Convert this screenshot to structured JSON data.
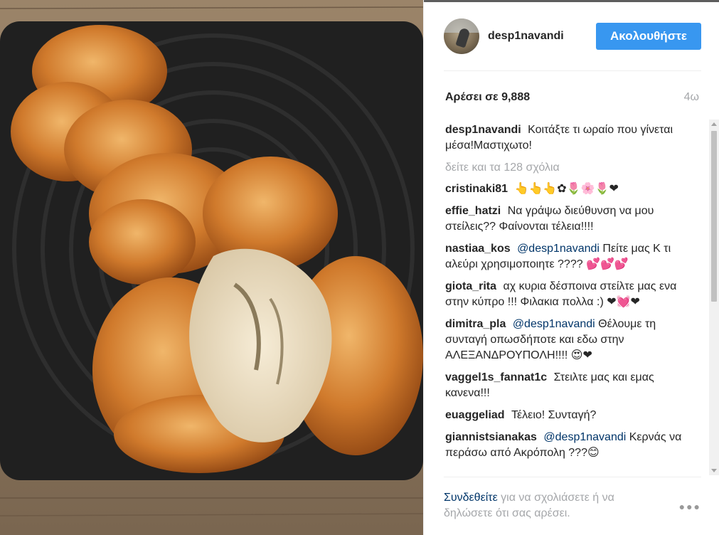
{
  "post": {
    "image_alt": "Braided mastic bread on a dark wooden plate",
    "username": "desp1navandi",
    "follow_label": "Ακολουθήστε",
    "likes_text": "Αρέσει σε 9,888",
    "time_ago": "4ω"
  },
  "caption": {
    "author": "desp1navandi",
    "text": "Κοιτάξτε τι ωραίο που γίνεται μέσα!Μαστιχωτο!"
  },
  "view_all_label": "δείτε και τα 128 σχόλια",
  "comments": [
    {
      "author": "cristinaki81",
      "text": "👆👆👆✿🌷🌸🌷❤"
    },
    {
      "author": "effie_hatzi",
      "text": "Να γράψω διεύθυνση να μου στείλεις?? Φαίνονται τέλεια!!!!"
    },
    {
      "author": "nastiaa_kos",
      "mention": "@desp1navandi",
      "text": "Πείτε μας Κ τι αλεύρι χρησιμοποιητε ???? 💕💕💕"
    },
    {
      "author": "giota_rita",
      "text": "αχ κυρια δέσποινα στείλτε μας ενα στην κύπρο !!! Φιλακια πολλα :) ❤💓❤"
    },
    {
      "author": "dimitra_pla",
      "mention": "@desp1navandi",
      "text": "Θέλουμε τη συνταγή οπωσδήποτε και εδω στην ΑΛΕΞΑΝΔΡΟΥΠΟΛΗ!!!! 😍❤"
    },
    {
      "author": "vaggel1s_fannat1c",
      "text": "Στειλτε μας και εμας κανενα!!!"
    },
    {
      "author": "euaggeliad",
      "text": "Τέλειο! Συνταγή?"
    },
    {
      "author": "giannistsianakas",
      "mention": "@desp1navandi",
      "text": "Κερνάς να περάσω από Ακρόπολη ???😊"
    }
  ],
  "footer": {
    "login_link": "Συνδεθείτε",
    "rest_text": "για να σχολιάσετε ή να δηλώσετε ότι σας αρέσει."
  },
  "icons": {
    "options": "more-options-icon"
  },
  "colors": {
    "accent": "#3897f0",
    "link": "#003569",
    "muted": "#a5a7aa"
  }
}
